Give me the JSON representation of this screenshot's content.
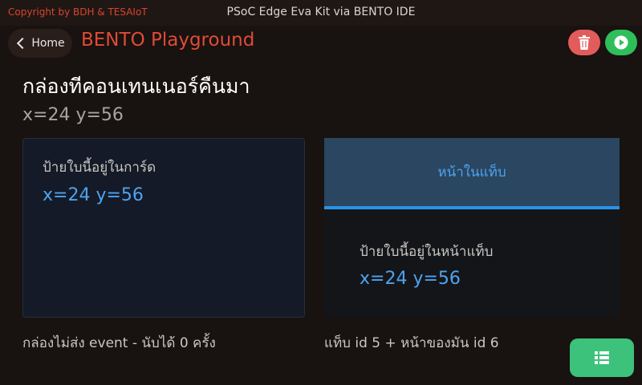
{
  "topbar": {
    "copyright": "Copyright by BDH & TESAIoT",
    "window_title": "PSoC Edge Eva Kit via BENTO IDE"
  },
  "header": {
    "home_label": "Home",
    "app_title": "BENTO Playground",
    "delete_icon": "trash-icon",
    "run_icon": "play-icon"
  },
  "main": {
    "title": "กล่องทีคอนเทนเนอร์คืนมา",
    "coords": "x=24 y=56"
  },
  "card": {
    "label": "ป้ายใบนี้อยู่ในการ์ด",
    "coords": "x=24 y=56"
  },
  "tabview": {
    "tab_label": "หน้าในแท็บ",
    "page_label": "ป้ายใบนี้อยู่ในหน้าแท็บ",
    "page_coords": "x=24 y=56"
  },
  "status": {
    "left": "กล่องไม่ส่ง event - นับได้ 0 ครั้ง",
    "right": "แท็บ id 5 + หน้าของมัน id 6"
  },
  "fab": {
    "icon": "list-icon"
  },
  "colors": {
    "accent_red": "#e04b35",
    "accent_blue": "#4da3f0",
    "delete": "#e25c5c",
    "run": "#2ebe5a",
    "fab": "#3cc27a"
  }
}
